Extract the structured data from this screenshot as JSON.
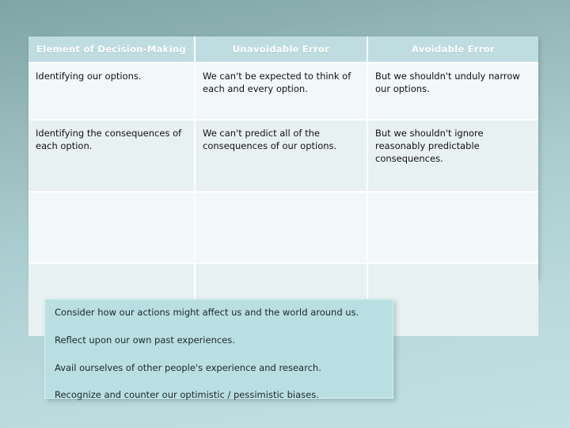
{
  "slide": {
    "background_top_color": "#7fa5a7",
    "background_bottom_color": "#c2e0e3"
  },
  "table": {
    "header_bg_color": "#bfdde0",
    "header_text_color": "#ffffff",
    "row_band_a_color": "#f2f7f9",
    "row_band_b_color": "#e8f1f1",
    "headers": [
      "Element of Decision-Making",
      "Unavoidable Error",
      "Avoidable Error"
    ],
    "rows": [
      [
        "Identifying our options.",
        "We can't be expected to think of each and every option.",
        "But we shouldn't unduly narrow our options."
      ],
      [
        "Identifying the consequences of each option.",
        "We can't predict all of the consequences of our options.",
        "But we shouldn't ignore reasonably predictable consequences."
      ],
      [
        "",
        "",
        ""
      ],
      [
        "",
        "",
        ""
      ]
    ]
  },
  "callout": {
    "bg_color": "#badfe3",
    "border_color": "#d9eef0",
    "lines": [
      "Consider how our actions might affect us and the world around us.",
      "Reflect upon our own past experiences.",
      "Avail ourselves of other people's experience and research.",
      "Recognize and counter our optimistic / pessimistic biases."
    ]
  },
  "connector": {
    "color": "#7e9fa4"
  }
}
